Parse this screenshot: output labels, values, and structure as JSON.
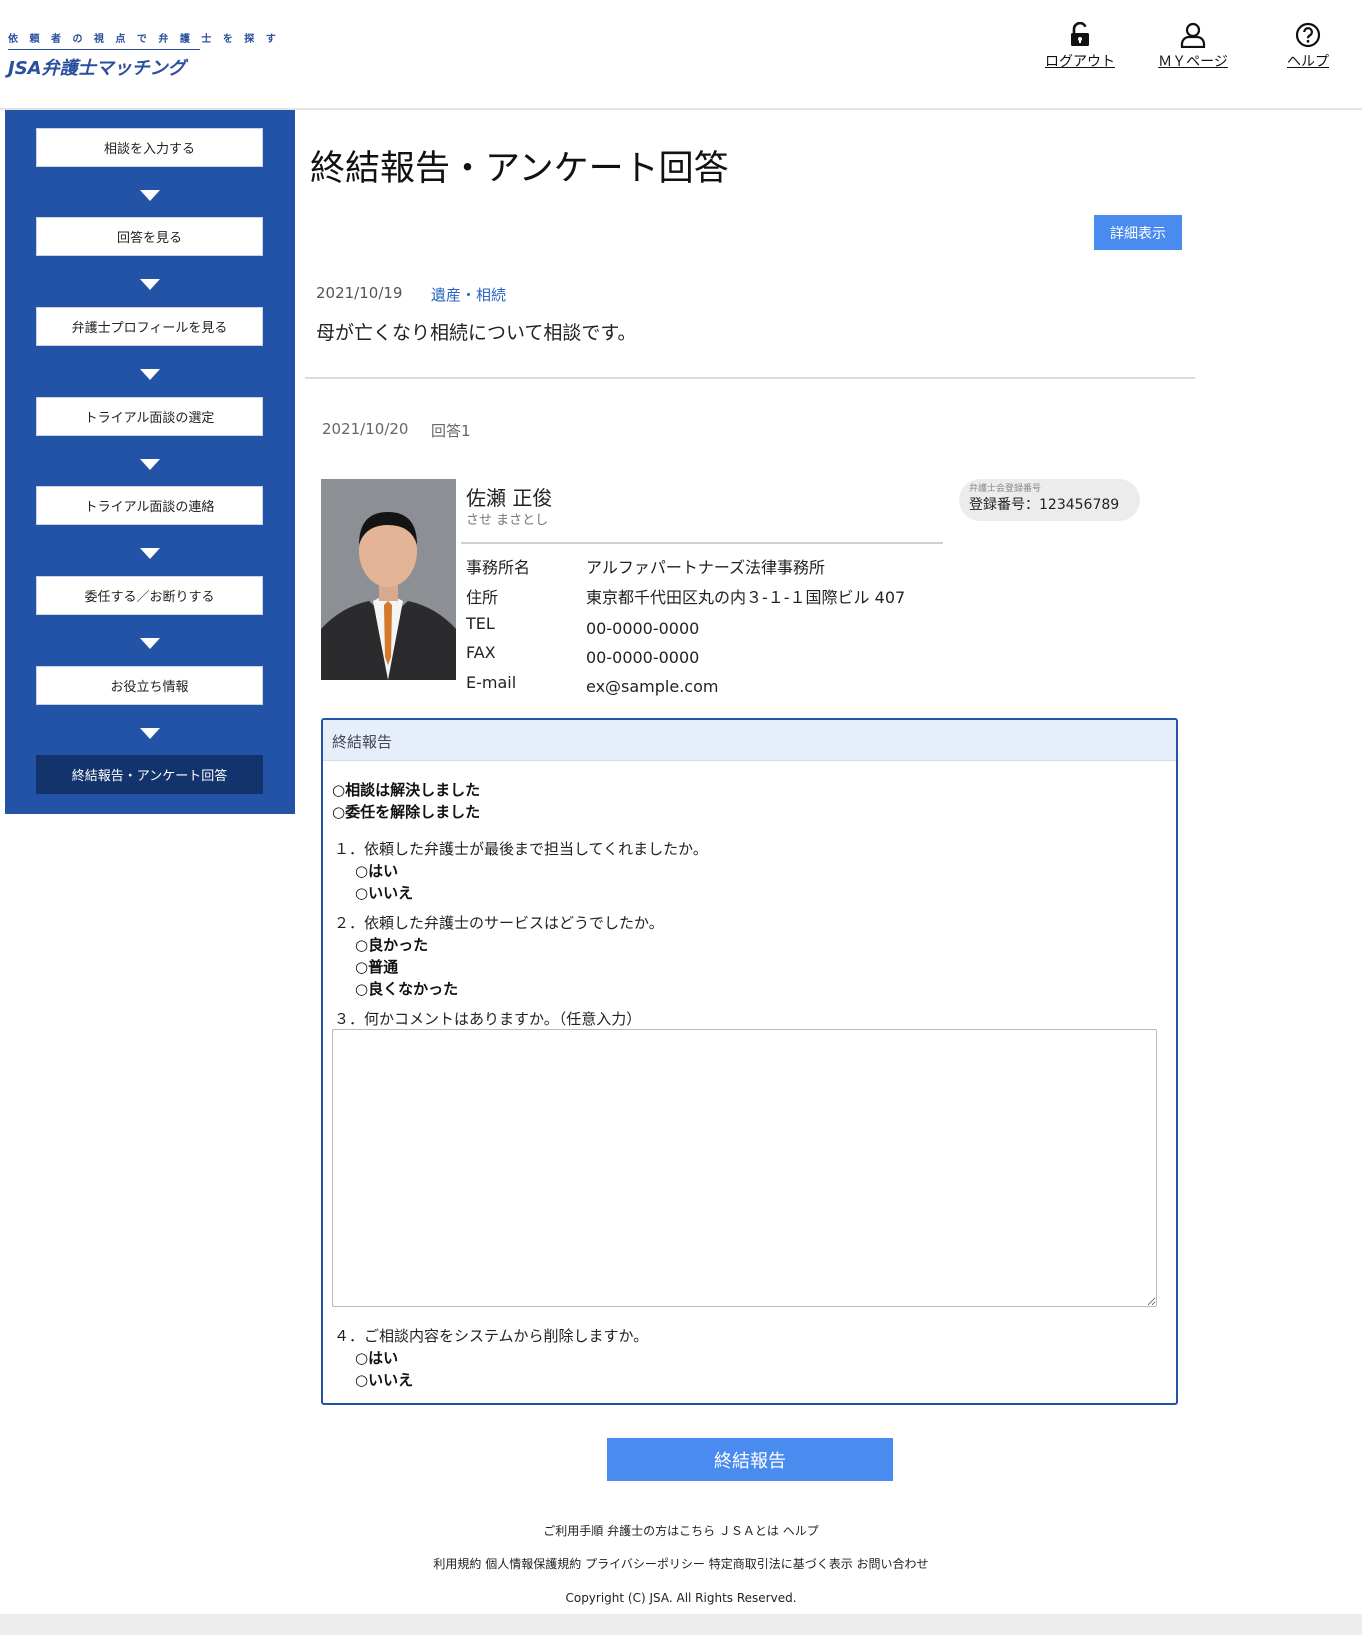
{
  "header": {
    "logo_tagline": "依 頼 者 の 視 点 で 弁 護 士 を 探 す",
    "logo_name": "JSA弁護士マッチング",
    "links": [
      {
        "label": "ログアウト",
        "icon": "unlock-icon"
      },
      {
        "label": "ＭＹページ",
        "icon": "user-icon"
      },
      {
        "label": "ヘルプ",
        "icon": "help-icon"
      }
    ]
  },
  "sidebar": {
    "steps": [
      {
        "label": "相談を入力する"
      },
      {
        "label": "回答を見る"
      },
      {
        "label": "弁護士プロフィールを見る"
      },
      {
        "label": "トライアル面談の選定"
      },
      {
        "label": "トライアル面談の連絡"
      },
      {
        "label": "委任する／お断りする"
      },
      {
        "label": "お役立ち情報"
      },
      {
        "label": "終結報告・アンケート回答"
      }
    ],
    "active_index": 7
  },
  "main": {
    "title": "終結報告・アンケート回答",
    "detail_button": "詳細表示",
    "consultation": {
      "date": "2021/10/19",
      "category": "遺産・相続",
      "text": "母が亡くなり相続について相談です。"
    },
    "answer": {
      "date": "2021/10/20",
      "label": "回答1"
    },
    "lawyer": {
      "name": "佐瀬 正俊",
      "kana": "させ まさとし",
      "registration_caption": "弁護士会登録番号",
      "registration": "登録番号：123456789",
      "fields": [
        {
          "label": "事務所名",
          "value": "アルファパートナーズ法律事務所"
        },
        {
          "label": "住所",
          "value": "東京都千代田区丸の内３-１-１国際ビル 407"
        },
        {
          "label": "TEL",
          "value": "00-0000-0000"
        },
        {
          "label": "FAX",
          "value": "00-0000-0000"
        },
        {
          "label": "E-mail",
          "value": "ex@sample.com"
        }
      ]
    }
  },
  "report": {
    "heading": "終結報告",
    "status_options": [
      "相談は解決しました",
      "委任を解除しました"
    ],
    "q1": {
      "text": "１．依頼した弁護士が最後まで担当してくれましたか。",
      "options": [
        "はい",
        "いいえ"
      ]
    },
    "q2": {
      "text": "２．依頼した弁護士のサービスはどうでしたか。",
      "options": [
        "良かった",
        "普通",
        "良くなかった"
      ]
    },
    "q3": {
      "text": "３．何かコメントはありますか。（任意入力）",
      "value": ""
    },
    "q4": {
      "text": "４．ご相談内容をシステムから削除しますか。",
      "options": [
        "はい",
        "いいえ"
      ]
    },
    "submit": "終結報告"
  },
  "footer": {
    "row1": [
      "ご利用手順",
      "弁護士の方はこちら",
      "ＪＳＡとは",
      "ヘルプ"
    ],
    "row2": [
      "利用規約",
      "個人情報保護規約",
      "プライバシーポリシー",
      "特定商取引法に基づく表示",
      "お問い合わせ"
    ],
    "copyright": "Copyright (C) JSA. All Rights Reserved."
  }
}
